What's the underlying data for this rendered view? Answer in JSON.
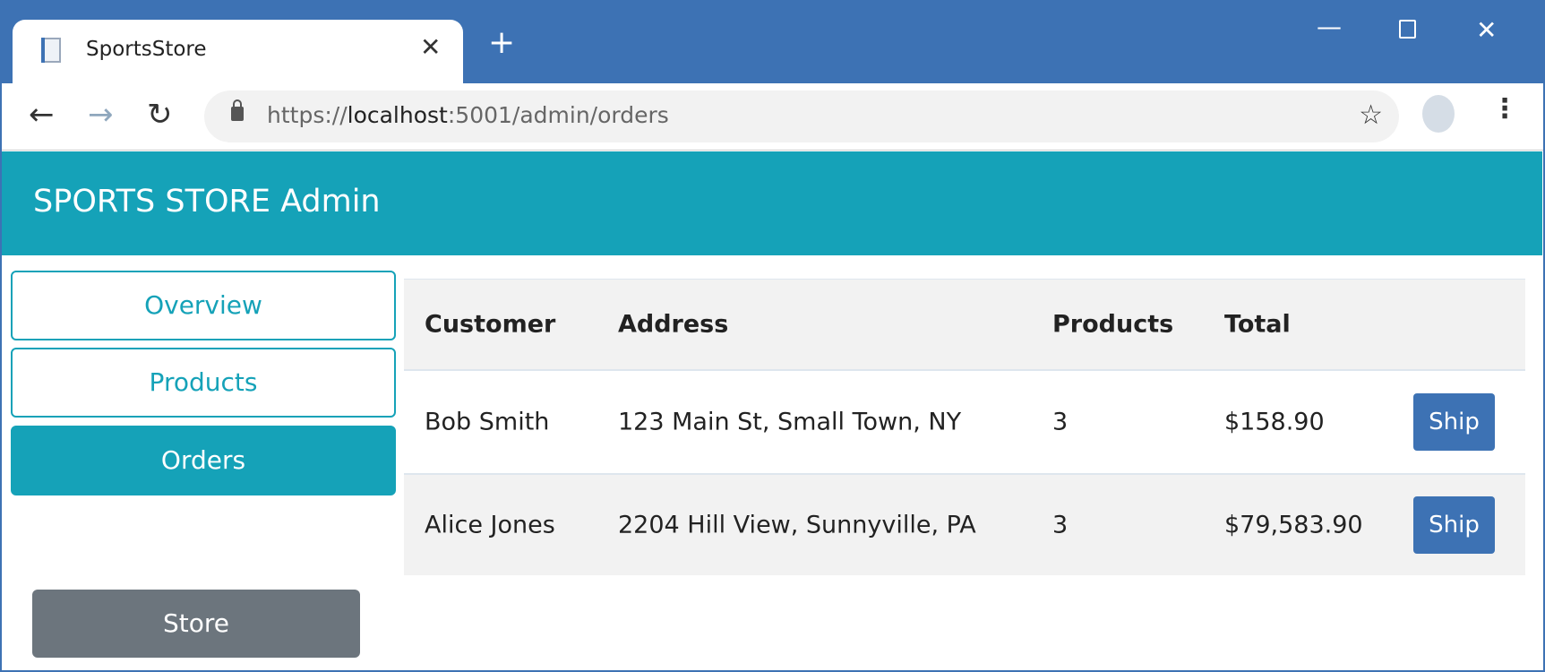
{
  "browser": {
    "tab_title": "SportsStore",
    "url_scheme": "https://",
    "url_host": "localhost",
    "url_rest": ":5001/admin/orders"
  },
  "app": {
    "title": "SPORTS STORE Admin",
    "accent_color": "#15a2b8"
  },
  "sidebar": {
    "items": [
      {
        "label": "Overview",
        "active": false
      },
      {
        "label": "Products",
        "active": false
      },
      {
        "label": "Orders",
        "active": true
      }
    ],
    "store_label": "Store"
  },
  "orders": {
    "columns": [
      "Customer",
      "Address",
      "Products",
      "Total"
    ],
    "rows": [
      {
        "customer": "Bob Smith",
        "address": "123 Main St, Small Town, NY",
        "products": "3",
        "total": "$158.90",
        "action": "Ship"
      },
      {
        "customer": "Alice Jones",
        "address": "2204 Hill View, Sunnyville, PA",
        "products": "3",
        "total": "$79,583.90",
        "action": "Ship"
      }
    ]
  }
}
